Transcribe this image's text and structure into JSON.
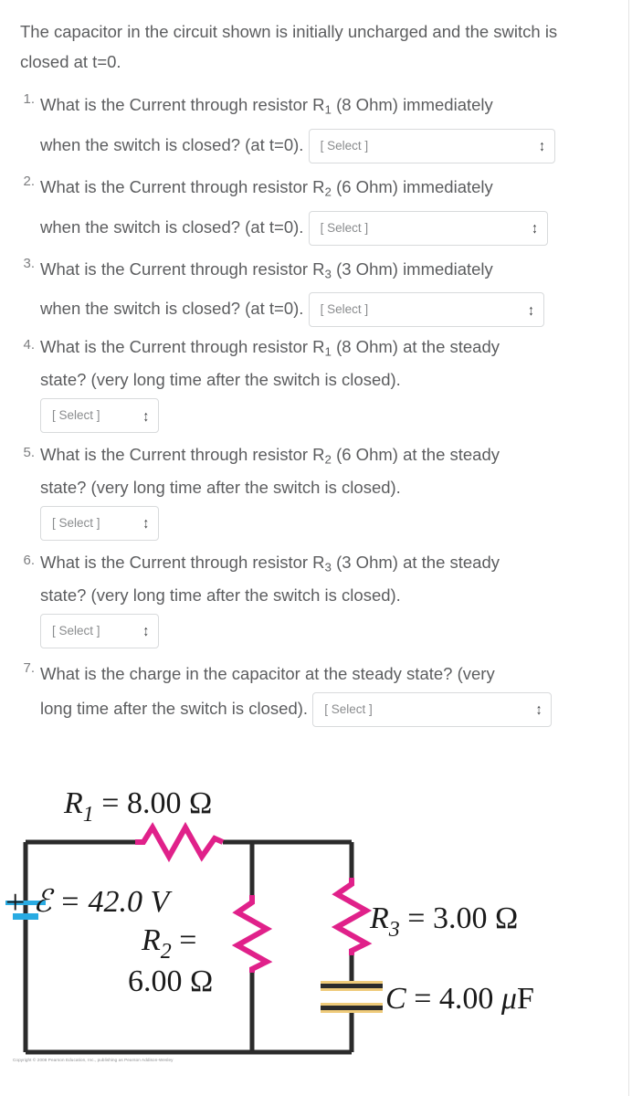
{
  "intro": {
    "text": "The capacitor in the circuit shown is initially uncharged and the switch is closed at t=0."
  },
  "select": {
    "placeholder": "[ Select ]",
    "caret_icon": "chevron-up-down-icon"
  },
  "questions": [
    {
      "number": "1.",
      "line1_a": "What is the Current through resistor R",
      "line1_sub": "1",
      "line1_b": " (8 Ohm) immediately",
      "line2": "when the switch is closed? (at t=0).",
      "layout": "inline"
    },
    {
      "number": "2.",
      "line1_a": "What is the Current through resistor R",
      "line1_sub": "2",
      "line1_b": " (6 Ohm) immediately",
      "line2": "when the switch is closed? (at t=0).",
      "layout": "inline"
    },
    {
      "number": "3.",
      "line1_a": "What is the Current through resistor R",
      "line1_sub": "3",
      "line1_b": " (3 Ohm) immediately",
      "line2": "when the switch is closed? (at t=0).",
      "layout": "inline"
    },
    {
      "number": "4.",
      "line1_a": "What is the Current through resistor R",
      "line1_sub": "1",
      "line1_b": " (8 Ohm) at the steady",
      "line2": "state? (very long time after the switch is closed).",
      "layout": "block"
    },
    {
      "number": "5.",
      "line1_a": "What is the Current through resistor R",
      "line1_sub": "2",
      "line1_b": " (6 Ohm) at the steady",
      "line2": "state? (very long time after the switch is closed).",
      "layout": "block"
    },
    {
      "number": "6.",
      "line1_a": "What is the Current through resistor R",
      "line1_sub": "3",
      "line1_b": " (3 Ohm) at the steady",
      "line2": "state? (very long time after the switch is closed).",
      "layout": "block"
    },
    {
      "number": "7.",
      "line1_a": "What is the charge in the capacitor at the steady state? (very",
      "line1_sub": "",
      "line1_b": "",
      "line2": "long time after the switch is closed).",
      "layout": "inline"
    }
  ],
  "figure": {
    "labels": {
      "r1": "R",
      "r1_sub": "1",
      "r1_value": " = 8.00 Ω",
      "emf_plus": "+",
      "emf": "ℰ = 42.0 V",
      "r2": "R",
      "r2_sub": "2",
      "r2_eq": " =",
      "r2_value": "6.00 Ω",
      "r3": "R",
      "r3_sub": "3",
      "r3_value": " = 3.00 Ω",
      "c_value": "C = 4.00 μF"
    },
    "copyright": "Copyright © 2008 Pearson Education, Inc., publishing as Pearson Addison-Wesley",
    "colors": {
      "wire": "#2b2b2b",
      "resistor": "#e0218a",
      "battery": "#29abe2",
      "capacitor_plate": "#2b2b2b",
      "capacitor_highlight": "#efcb7a"
    }
  }
}
